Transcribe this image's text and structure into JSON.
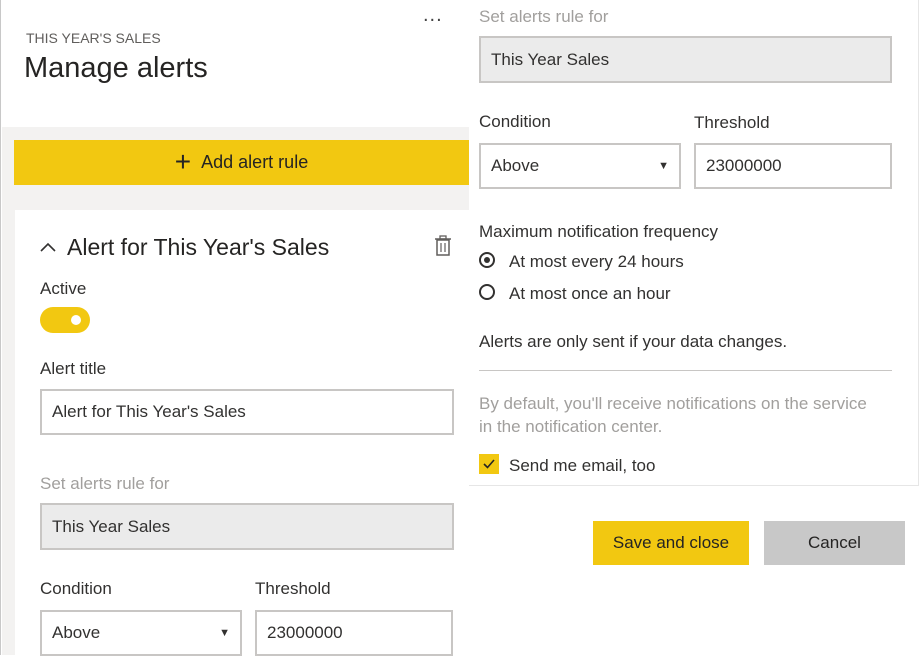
{
  "header": {
    "subtitle": "THIS YEAR'S SALES",
    "title": "Manage alerts",
    "more_icon": "more-horizontal-icon",
    "more_text": "..."
  },
  "add_rule": {
    "label": "Add alert rule",
    "icon": "plus-icon"
  },
  "alert_card": {
    "heading": "Alert for This Year's Sales",
    "active_label": "Active",
    "active": true,
    "alert_title_label": "Alert title",
    "alert_title_value": "Alert for This Year's Sales",
    "rule_for_label": "Set alerts rule for",
    "rule_for_value": "This Year Sales",
    "condition_label": "Condition",
    "condition_value": "Above",
    "threshold_label": "Threshold",
    "threshold_value": "23000000"
  },
  "rule_panel": {
    "rule_for_label": "Set alerts rule for",
    "rule_for_value": "This Year Sales",
    "condition_label": "Condition",
    "condition_value": "Above",
    "threshold_label": "Threshold",
    "threshold_value": "23000000",
    "frequency_label": "Maximum notification frequency",
    "frequency_options": [
      "At most every 24 hours",
      "At most once an hour"
    ],
    "frequency_selected": 0,
    "info_text": "Alerts are only sent if your data changes.",
    "default_text_line1": "By default, you'll receive notifications on the service",
    "default_text_line2": "in the notification center.",
    "email_label": "Send me email, too",
    "email_checked": true
  },
  "actions": {
    "save_label": "Save and close",
    "cancel_label": "Cancel"
  },
  "colors": {
    "accent": "#f2c811",
    "cancel": "#c8c8c8",
    "panel_bg": "#f3f2f1",
    "disabled_field": "#ebebeb"
  }
}
